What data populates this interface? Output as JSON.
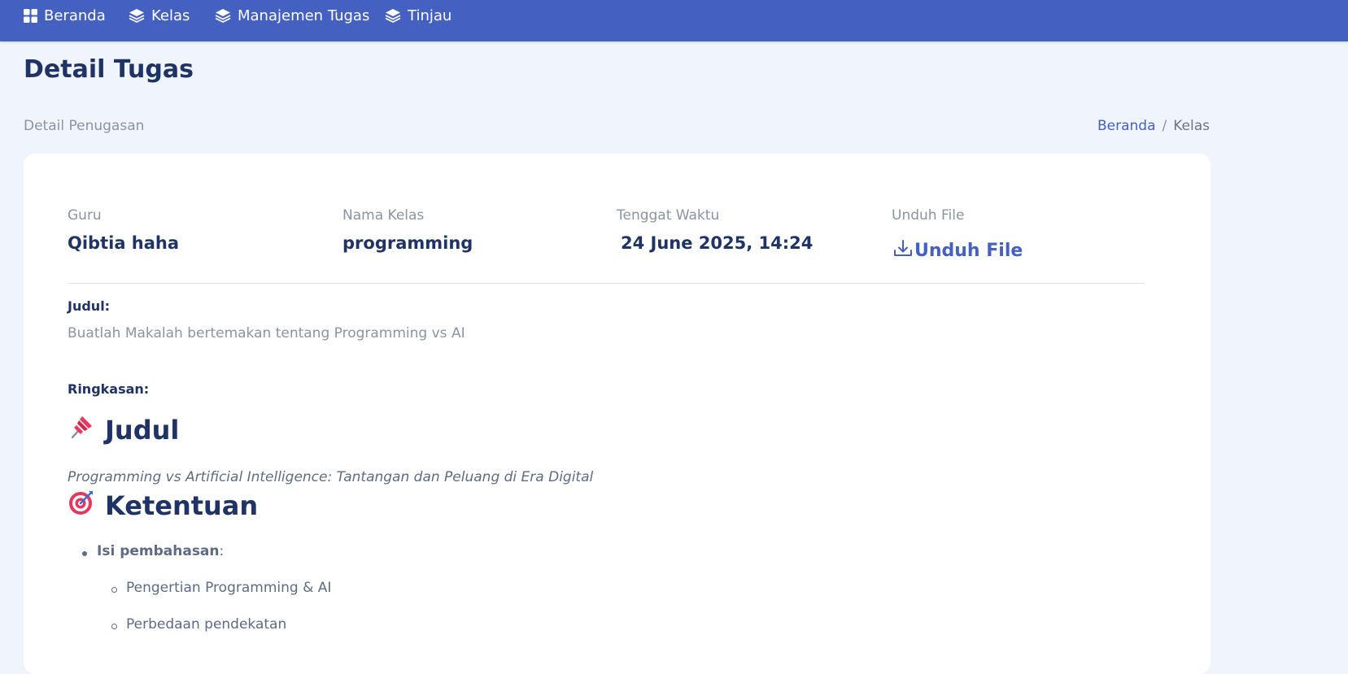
{
  "nav": {
    "items": [
      {
        "label": "Beranda",
        "icon": "grid-icon"
      },
      {
        "label": "Kelas",
        "icon": "layers-icon"
      },
      {
        "label": "Manajemen Tugas",
        "icon": "layers-icon"
      },
      {
        "label": "Tinjau",
        "icon": "layers-icon"
      }
    ]
  },
  "page": {
    "title": "Detail Tugas",
    "subtitle": "Detail Penugasan"
  },
  "breadcrumb": {
    "home": "Beranda",
    "separator": "/",
    "current": "Kelas"
  },
  "meta": {
    "teacher_label": "Guru",
    "teacher_value": "Qibtia haha",
    "class_label": "Nama Kelas",
    "class_value": "programming",
    "deadline_label": "Tenggat Waktu",
    "deadline_value": "24 June 2025, 14:24",
    "download_label": "Unduh File",
    "download_link": "Unduh File"
  },
  "assignment": {
    "title_label": "Judul:",
    "title_value": "Buatlah Makalah bertemakan tentang Programming vs AI",
    "summary_label": "Ringkasan:",
    "summary": {
      "heading1": "Judul",
      "heading1_icon": "pushpin-icon",
      "subtitle": "Programming vs Artificial Intelligence: Tantangan dan Peluang di Era Digital",
      "heading2": "Ketentuan",
      "heading2_icon": "target-icon",
      "item_bold": "Isi pembahasan",
      "item_suffix": ":",
      "subitems": [
        "Pengertian Programming & AI",
        "Perbedaan pendekatan"
      ]
    }
  },
  "colors": {
    "navbar": "#4460c0",
    "background": "#f0f5fd",
    "heading": "#1f3366",
    "muted": "#8a94a3",
    "link": "#4460c0"
  }
}
